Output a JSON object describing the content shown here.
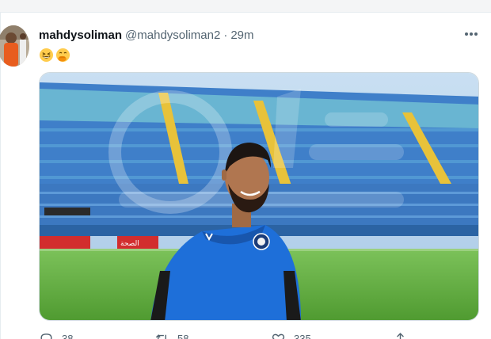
{
  "tweet": {
    "display_name": "mahdysoliman",
    "handle": "@mahdysoliman2",
    "separator": "·",
    "time": "29m",
    "emojis": [
      "grinning-squinting-face",
      "face-with-hand-over-mouth"
    ],
    "media": {
      "description_icon": "photo",
      "ad_board_text": "الصحة"
    },
    "actions": {
      "reply_count": "38",
      "retweet_count": "58",
      "like_count": "335"
    }
  },
  "colors": {
    "text_primary": "#0f1419",
    "text_secondary": "#536471",
    "border": "#cfd9de",
    "jersey_blue": "#1e6fd9",
    "pitch_green": "#5cae3c"
  }
}
